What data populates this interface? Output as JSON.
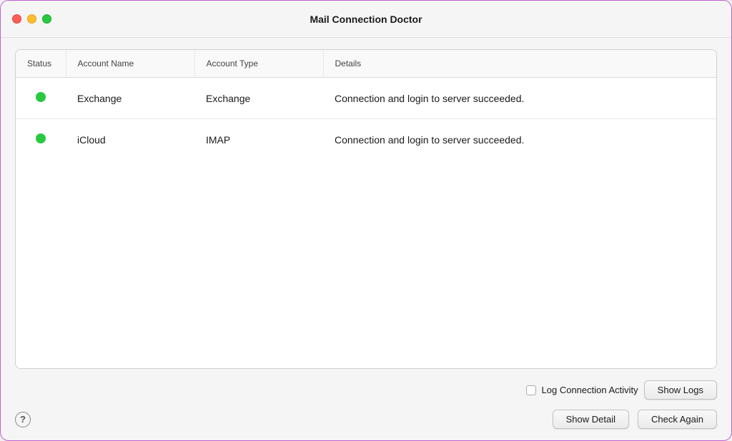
{
  "window": {
    "title": "Mail Connection Doctor"
  },
  "table": {
    "columns": [
      {
        "key": "status",
        "label": "Status"
      },
      {
        "key": "account_name",
        "label": "Account Name"
      },
      {
        "key": "account_type",
        "label": "Account Type"
      },
      {
        "key": "details",
        "label": "Details"
      }
    ],
    "rows": [
      {
        "status": "green",
        "account_name": "Exchange",
        "account_type": "Exchange",
        "details": "Connection and login to server succeeded."
      },
      {
        "status": "green",
        "account_name": "iCloud",
        "account_type": "IMAP",
        "details": "Connection and login to server succeeded."
      }
    ]
  },
  "bottom": {
    "log_checkbox_label": "Log Connection Activity",
    "show_logs_label": "Show Logs",
    "show_detail_label": "Show Detail",
    "check_again_label": "Check Again",
    "help_label": "?"
  }
}
